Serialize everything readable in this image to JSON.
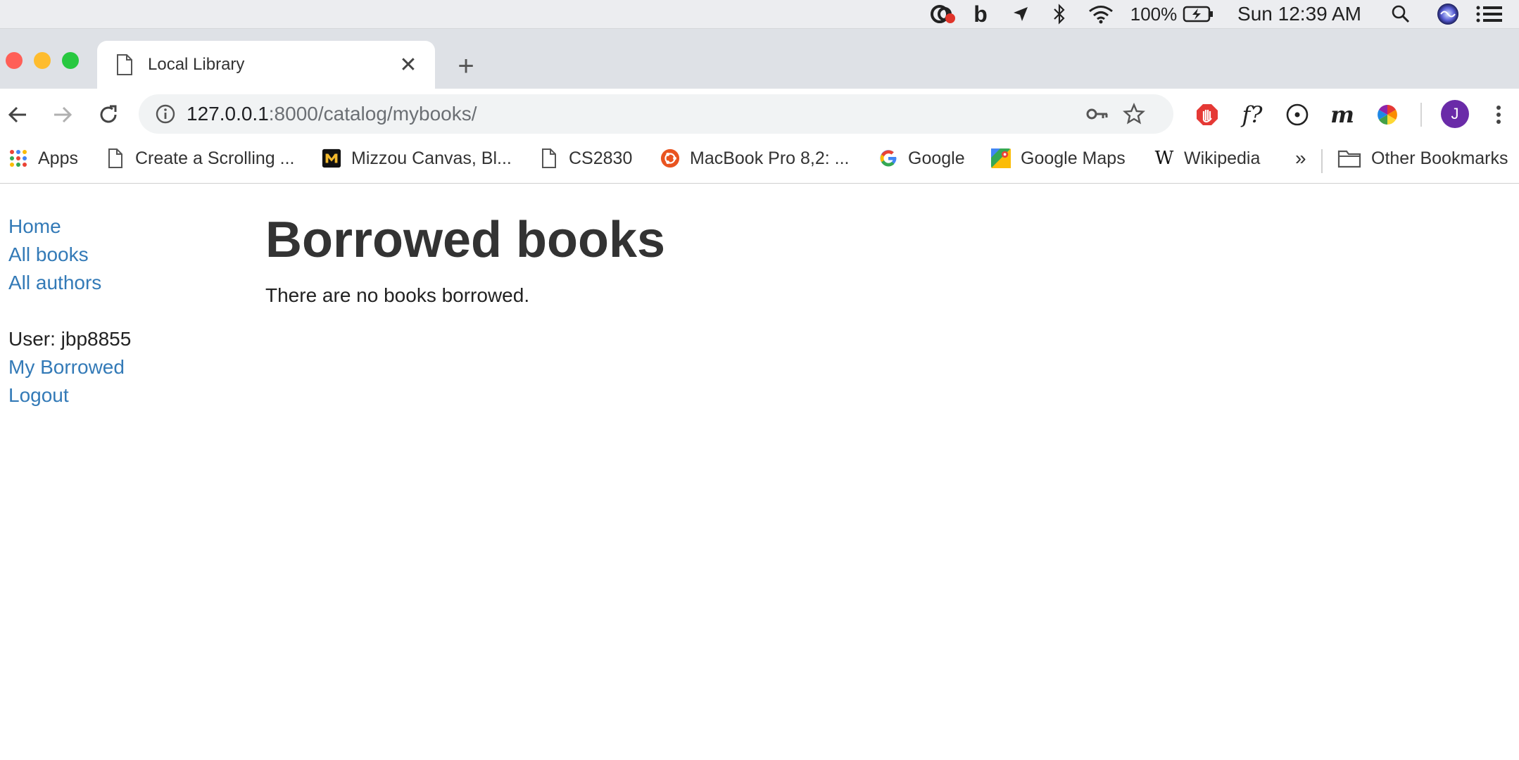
{
  "menubar": {
    "battery": "100%",
    "clock": "Sun 12:39 AM",
    "icons": [
      "creative-cloud-icon",
      "b-icon",
      "location-icon",
      "bluetooth-icon",
      "wifi-icon",
      "battery-icon",
      "spotlight-search-icon",
      "siri-icon",
      "notification-center-icon"
    ]
  },
  "tab": {
    "title": "Local Library",
    "close_label": "✕",
    "new_tab_label": "+"
  },
  "omnibox": {
    "host": "127.0.0.1",
    "rest": ":8000/catalog/mybooks/"
  },
  "profile": {
    "initial": "J",
    "color": "#6a2ba8"
  },
  "bookmarks": {
    "apps": "Apps",
    "items": [
      {
        "label": "Create a Scrolling ...",
        "icon": "page-icon"
      },
      {
        "label": "Mizzou Canvas, Bl...",
        "icon": "mizzou-icon"
      },
      {
        "label": "CS2830",
        "icon": "page-icon"
      },
      {
        "label": "MacBook Pro 8,2: ...",
        "icon": "ubuntu-icon"
      },
      {
        "label": "Google",
        "icon": "google-icon"
      },
      {
        "label": "Google Maps",
        "icon": "maps-icon"
      },
      {
        "label": "Wikipedia",
        "icon": "wikipedia-icon"
      }
    ],
    "overflow": "»",
    "other": "Other Bookmarks"
  },
  "sidebar": {
    "home": "Home",
    "all_books": "All books",
    "all_authors": "All authors",
    "user": "User: jbp8855",
    "my_borrowed": "My Borrowed",
    "logout": "Logout"
  },
  "main": {
    "title": "Borrowed books",
    "message": "There are no books borrowed."
  },
  "colors": {
    "link": "#337ab7",
    "tab_strip": "#dee1e6",
    "close": "#ff5f57",
    "minimize": "#febc2e",
    "zoom": "#28c840"
  }
}
